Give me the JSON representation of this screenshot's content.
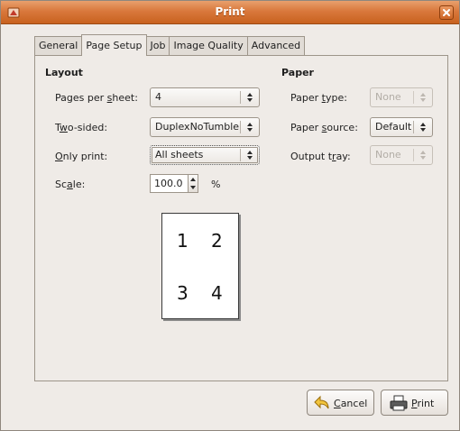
{
  "window": {
    "title": "Print"
  },
  "tabs": [
    {
      "label": "General"
    },
    {
      "label": "Page Setup",
      "active": true
    },
    {
      "label": "Job"
    },
    {
      "label": "Image Quality"
    },
    {
      "label": "Advanced"
    }
  ],
  "layout": {
    "heading": "Layout",
    "pages_per_sheet": {
      "label_pre": "Pages per ",
      "label_u": "s",
      "label_post": "heet:",
      "value": "4"
    },
    "two_sided": {
      "label_pre": "T",
      "label_u": "w",
      "label_post": "o-sided:",
      "value": "DuplexNoTumble"
    },
    "only_print": {
      "label_pre": "",
      "label_u": "O",
      "label_post": "nly print:",
      "value": "All sheets"
    },
    "scale": {
      "label_pre": "Sc",
      "label_u": "a",
      "label_post": "le:",
      "value": "100.0",
      "unit": "%"
    }
  },
  "paper": {
    "heading": "Paper",
    "paper_type": {
      "label_pre": "Paper ",
      "label_u": "t",
      "label_post": "ype:",
      "value": "None"
    },
    "paper_source": {
      "label_pre": "Paper ",
      "label_u": "s",
      "label_post": "ource:",
      "value": "Default"
    },
    "output_tray": {
      "label_pre": "Output t",
      "label_u": "r",
      "label_post": "ay:",
      "value": "None"
    }
  },
  "preview": {
    "pages": [
      "1",
      "2",
      "3",
      "4"
    ]
  },
  "buttons": {
    "cancel": {
      "label_u": "C",
      "label_post": "ancel",
      "icon": "undo-arrow-icon"
    },
    "print": {
      "label_u": "P",
      "label_post": "rint",
      "icon": "printer-icon"
    }
  },
  "colors": {
    "titlebar": "#d9783c",
    "window_bg": "#efebe7"
  }
}
